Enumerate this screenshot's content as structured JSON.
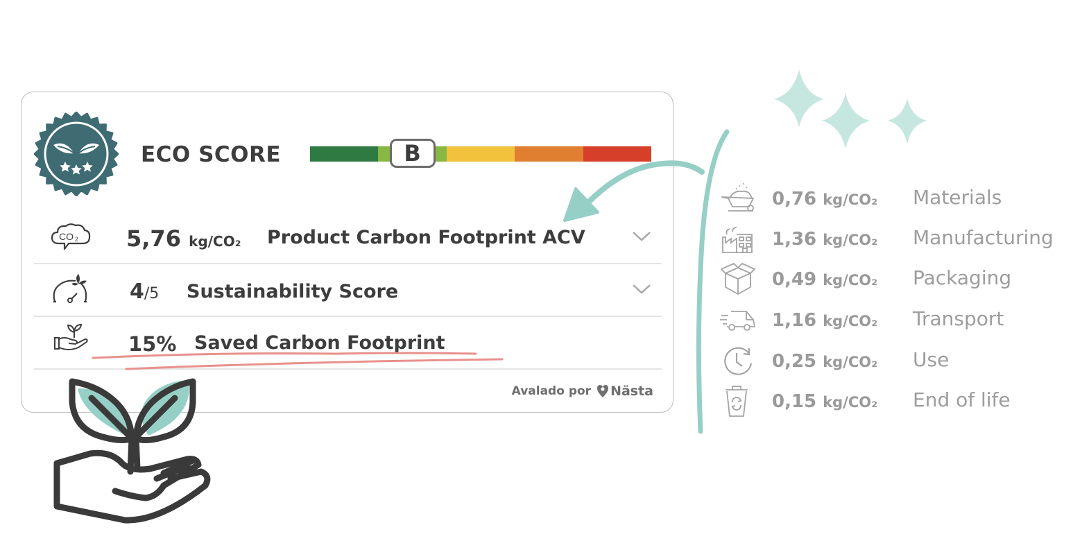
{
  "eco_card": {
    "title": "ECO SCORE",
    "grade": "B",
    "grade_index": 1,
    "scale_colors": [
      "#2e7a42",
      "#86b843",
      "#f3c23d",
      "#e07f2f",
      "#d6402b"
    ],
    "rows": [
      {
        "value": "5,76",
        "unit": "kg/CO₂",
        "label": "Product Carbon Footprint ACV",
        "icon": "co2-cloud-icon",
        "expandable": true
      },
      {
        "value": "4",
        "unit": "/5",
        "label": "Sustainability Score",
        "icon": "eco-gauge-icon",
        "expandable": true
      },
      {
        "value": "15%",
        "unit": "",
        "label": "Saved Carbon Footprint",
        "icon": "hand-plant-icon",
        "expandable": false
      }
    ],
    "footer": {
      "endorsed_by": "Avalado por",
      "brand": "Nästa"
    },
    "badge_color": "#3f6b72"
  },
  "breakdown": [
    {
      "value": "0,76",
      "unit": "kg/CO₂",
      "label": "Materials",
      "icon": "wheelbarrow-icon"
    },
    {
      "value": "1,36",
      "unit": "kg/CO₂",
      "label": "Manufacturing",
      "icon": "factory-icon"
    },
    {
      "value": "0,49",
      "unit": "kg/CO₂",
      "label": "Packaging",
      "icon": "box-icon"
    },
    {
      "value": "1,16",
      "unit": "kg/CO₂",
      "label": "Transport",
      "icon": "delivery-truck-icon"
    },
    {
      "value": "0,25",
      "unit": "kg/CO₂",
      "label": "Use",
      "icon": "clock-refresh-icon"
    },
    {
      "value": "0,15",
      "unit": "kg/CO₂",
      "label": "End of life",
      "icon": "recycle-bin-icon"
    }
  ],
  "colors": {
    "accent_teal": "#96cfc6",
    "sparkle": "#c6e6e0",
    "underline": "#e8918c",
    "text_dark": "#3d3d3d",
    "text_muted": "#9a9a9a"
  }
}
